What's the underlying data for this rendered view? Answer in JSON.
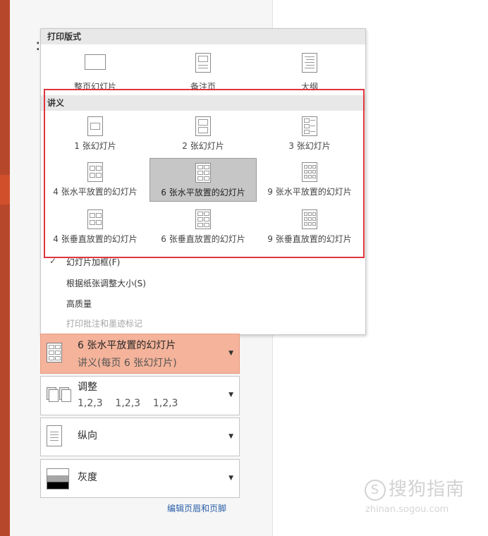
{
  "sections": {
    "print_layout": "打印版式",
    "handouts": "讲义"
  },
  "layout_options": [
    {
      "label": "整页幻灯片"
    },
    {
      "label": "备注页"
    },
    {
      "label": "大纲"
    }
  ],
  "handout_options": [
    {
      "label": "1 张幻灯片"
    },
    {
      "label": "2 张幻灯片"
    },
    {
      "label": "3 张幻灯片"
    },
    {
      "label": "4 张水平放置的幻灯片"
    },
    {
      "label": "6 张水平放置的幻灯片",
      "selected": true
    },
    {
      "label": "9 张水平放置的幻灯片"
    },
    {
      "label": "4 张垂直放置的幻灯片"
    },
    {
      "label": "6 张垂直放置的幻灯片"
    },
    {
      "label": "9 张垂直放置的幻灯片"
    }
  ],
  "menu_items": [
    {
      "label": "幻灯片加框(F)",
      "checked": true,
      "enabled": true
    },
    {
      "label": "根据纸张调整大小(S)",
      "checked": false,
      "enabled": true
    },
    {
      "label": "高质量",
      "checked": false,
      "enabled": true
    },
    {
      "label": "打印批注和墨迹标记",
      "checked": false,
      "enabled": false
    }
  ],
  "settings": {
    "layout": {
      "title": "6 张水平放置的幻灯片",
      "subtitle": "讲义(每页 6 张幻灯片)"
    },
    "collate": {
      "title": "调整",
      "subtitle": "1,2,3    1,2,3    1,2,3"
    },
    "orientation": {
      "title": "纵向"
    },
    "color": {
      "title": "灰度"
    }
  },
  "footer_link": "编辑页眉和页脚",
  "watermark": {
    "brand": "搜狗指南",
    "site": "zhinan.sogou.com"
  },
  "colors": {
    "accent": "#b7472a",
    "selected_card": "#f4b39a",
    "highlight_box": "#e0353d"
  }
}
